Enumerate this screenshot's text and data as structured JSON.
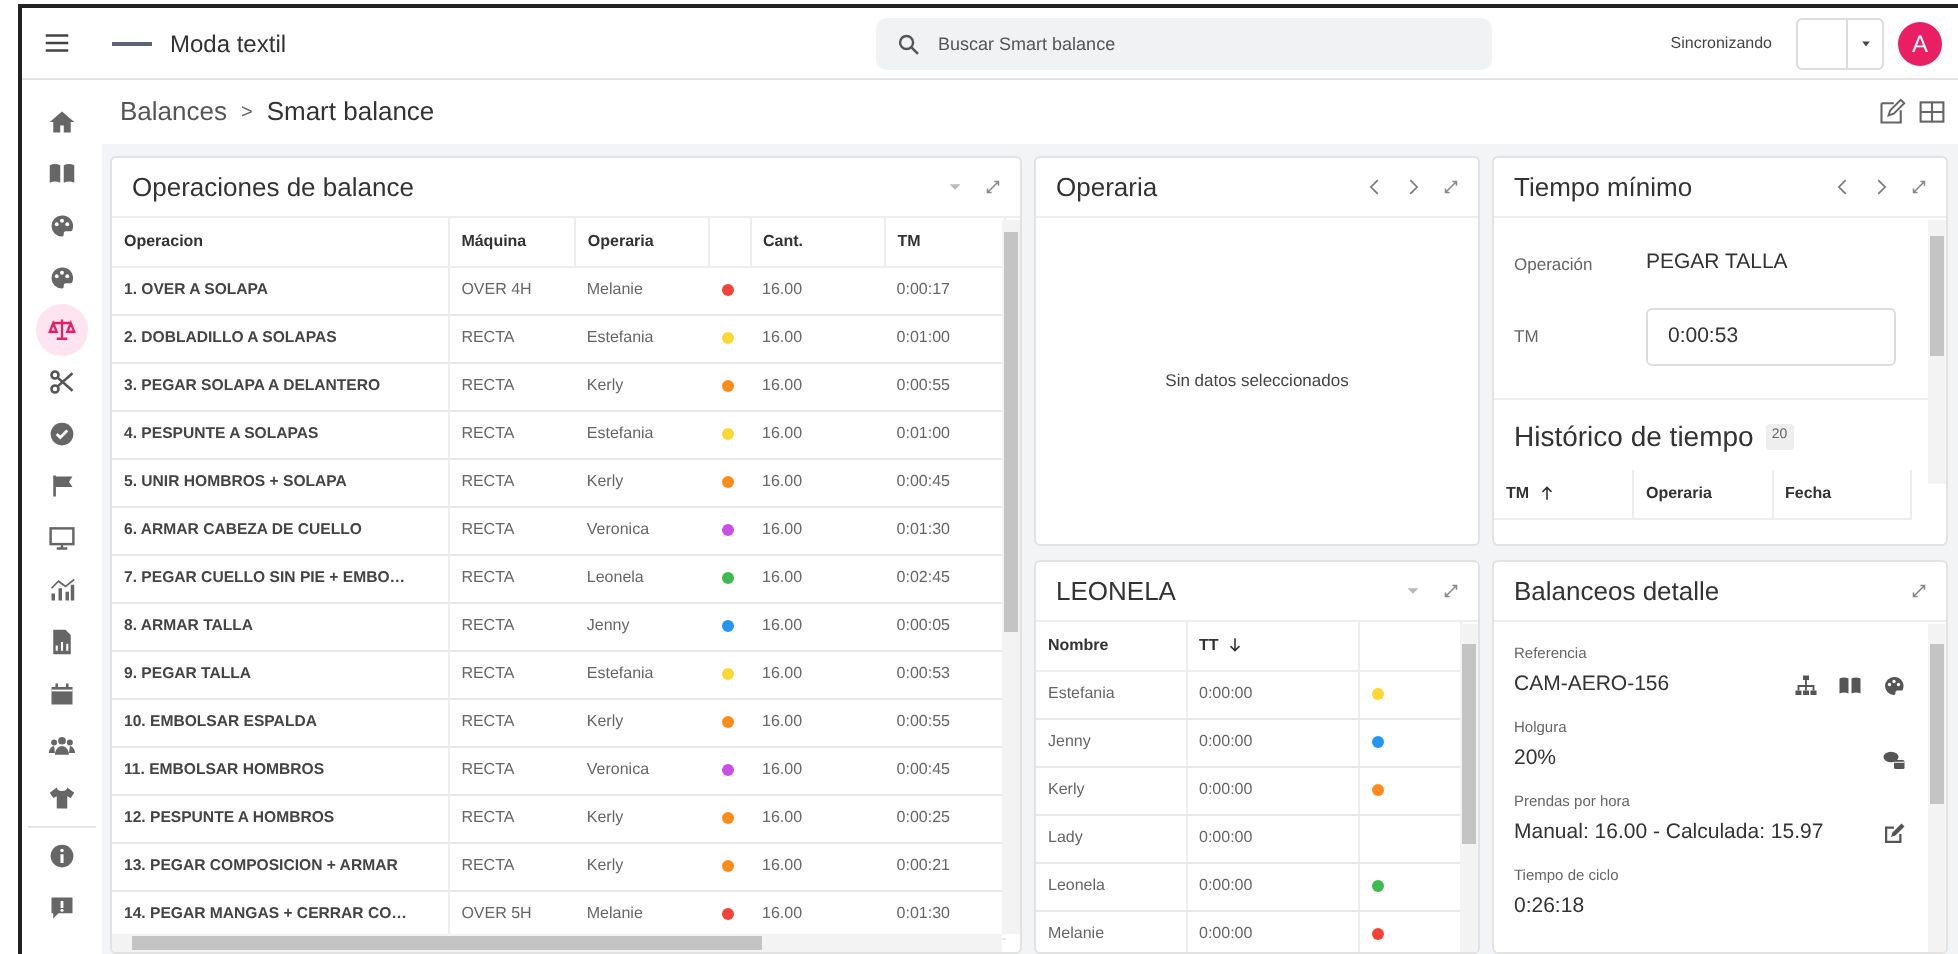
{
  "topbar": {
    "app_name": "Moda textil",
    "search": {
      "placeholder": "Buscar Smart balance"
    },
    "sync_label": "Sincronizando",
    "avatar": "A"
  },
  "sidebar": {
    "items": [
      {
        "selected": false
      },
      {
        "selected": false
      },
      {
        "selected": false
      },
      {
        "selected": false
      },
      {
        "selected": true
      },
      {
        "selected": false
      },
      {
        "selected": false
      },
      {
        "selected": false
      },
      {
        "selected": false
      },
      {
        "selected": false
      },
      {
        "selected": false
      },
      {
        "selected": false
      },
      {
        "selected": false
      },
      {
        "selected": false
      },
      {
        "selected": false
      },
      {
        "selected": false
      }
    ]
  },
  "breadcrumb": {
    "items": [
      "Balances",
      "Smart balance"
    ],
    "separator": ">"
  },
  "operations_panel": {
    "title": "Operaciones de balance",
    "columns": [
      "Operacion",
      "Máquina",
      "Operaria",
      "Cant.",
      "TM"
    ],
    "rows": [
      {
        "operacion": "1. OVER A SOLAPA",
        "maquina": "OVER 4H",
        "operaria": "Melanie",
        "color": "#f44336",
        "cant": "16.00",
        "tm": "0:00:17"
      },
      {
        "operacion": "2. DOBLADILLO A SOLAPAS",
        "maquina": "RECTA",
        "operaria": "Estefania",
        "color": "#fdd835",
        "cant": "16.00",
        "tm": "0:01:00"
      },
      {
        "operacion": "3. PEGAR SOLAPA A DELANTERO",
        "maquina": "RECTA",
        "operaria": "Kerly",
        "color": "#ff8c1a",
        "cant": "16.00",
        "tm": "0:00:55"
      },
      {
        "operacion": "4. PESPUNTE A SOLAPAS",
        "maquina": "RECTA",
        "operaria": "Estefania",
        "color": "#fdd835",
        "cant": "16.00",
        "tm": "0:01:00"
      },
      {
        "operacion": "5. UNIR HOMBROS + SOLAPA",
        "maquina": "RECTA",
        "operaria": "Kerly",
        "color": "#ff8c1a",
        "cant": "16.00",
        "tm": "0:00:45"
      },
      {
        "operacion": "6. ARMAR CABEZA DE CUELLO",
        "maquina": "RECTA",
        "operaria": "Veronica",
        "color": "#c850e6",
        "cant": "16.00",
        "tm": "0:01:30"
      },
      {
        "operacion": "7. PEGAR CUELLO SIN PIE + EMBO…",
        "maquina": "RECTA",
        "operaria": "Leonela",
        "color": "#3dbb4f",
        "cant": "16.00",
        "tm": "0:02:45"
      },
      {
        "operacion": "8. ARMAR TALLA",
        "maquina": "RECTA",
        "operaria": "Jenny",
        "color": "#2196f3",
        "cant": "16.00",
        "tm": "0:00:05"
      },
      {
        "operacion": "9. PEGAR TALLA",
        "maquina": "RECTA",
        "operaria": "Estefania",
        "color": "#fdd835",
        "cant": "16.00",
        "tm": "0:00:53"
      },
      {
        "operacion": "10. EMBOLSAR ESPALDA",
        "maquina": "RECTA",
        "operaria": "Kerly",
        "color": "#ff8c1a",
        "cant": "16.00",
        "tm": "0:00:55"
      },
      {
        "operacion": "11. EMBOLSAR HOMBROS",
        "maquina": "RECTA",
        "operaria": "Veronica",
        "color": "#c850e6",
        "cant": "16.00",
        "tm": "0:00:45"
      },
      {
        "operacion": "12. PESPUNTE A HOMBROS",
        "maquina": "RECTA",
        "operaria": "Kerly",
        "color": "#ff8c1a",
        "cant": "16.00",
        "tm": "0:00:25"
      },
      {
        "operacion": "13. PEGAR COMPOSICION + ARMAR",
        "maquina": "RECTA",
        "operaria": "Kerly",
        "color": "#ff8c1a",
        "cant": "16.00",
        "tm": "0:00:21"
      },
      {
        "operacion": "14. PEGAR MANGAS + CERRAR CO…",
        "maquina": "OVER 5H",
        "operaria": "Melanie",
        "color": "#f44336",
        "cant": "16.00",
        "tm": "0:01:30"
      }
    ]
  },
  "operaria_panel": {
    "title": "Operaria",
    "empty_message": "Sin datos seleccionados"
  },
  "tiempo_minimo_panel": {
    "title": "Tiempo mínimo",
    "operation_label": "Operación",
    "operation_value": "PEGAR TALLA",
    "tm_label": "TM",
    "tm_value": "0:00:53",
    "history_title": "Histórico de tiempo",
    "history_count": "20",
    "history_columns": [
      "TM",
      "Operaria",
      "Fecha"
    ]
  },
  "leonela_panel": {
    "title": "LEONELA",
    "columns": [
      "Nombre",
      "TT"
    ],
    "rows": [
      {
        "nombre": "Estefania",
        "tt": "0:00:00",
        "color": "#fdd835"
      },
      {
        "nombre": "Jenny",
        "tt": "0:00:00",
        "color": "#2196f3"
      },
      {
        "nombre": "Kerly",
        "tt": "0:00:00",
        "color": "#ff8c1a"
      },
      {
        "nombre": "Lady",
        "tt": "0:00:00"
      },
      {
        "nombre": "Leonela",
        "tt": "0:00:00",
        "color": "#3dbb4f"
      },
      {
        "nombre": "Melanie",
        "tt": "0:00:00",
        "color": "#f44336"
      }
    ]
  },
  "balanceos_panel": {
    "title": "Balanceos detalle",
    "fields": [
      {
        "label": "Referencia",
        "value": "CAM-AERO-156"
      },
      {
        "label": "Holgura",
        "value": "20%"
      },
      {
        "label": "Prendas por hora",
        "value": "Manual: 16.00 - Calculada: 15.97"
      },
      {
        "label": "Tiempo de ciclo",
        "value": "0:26:18"
      }
    ]
  }
}
